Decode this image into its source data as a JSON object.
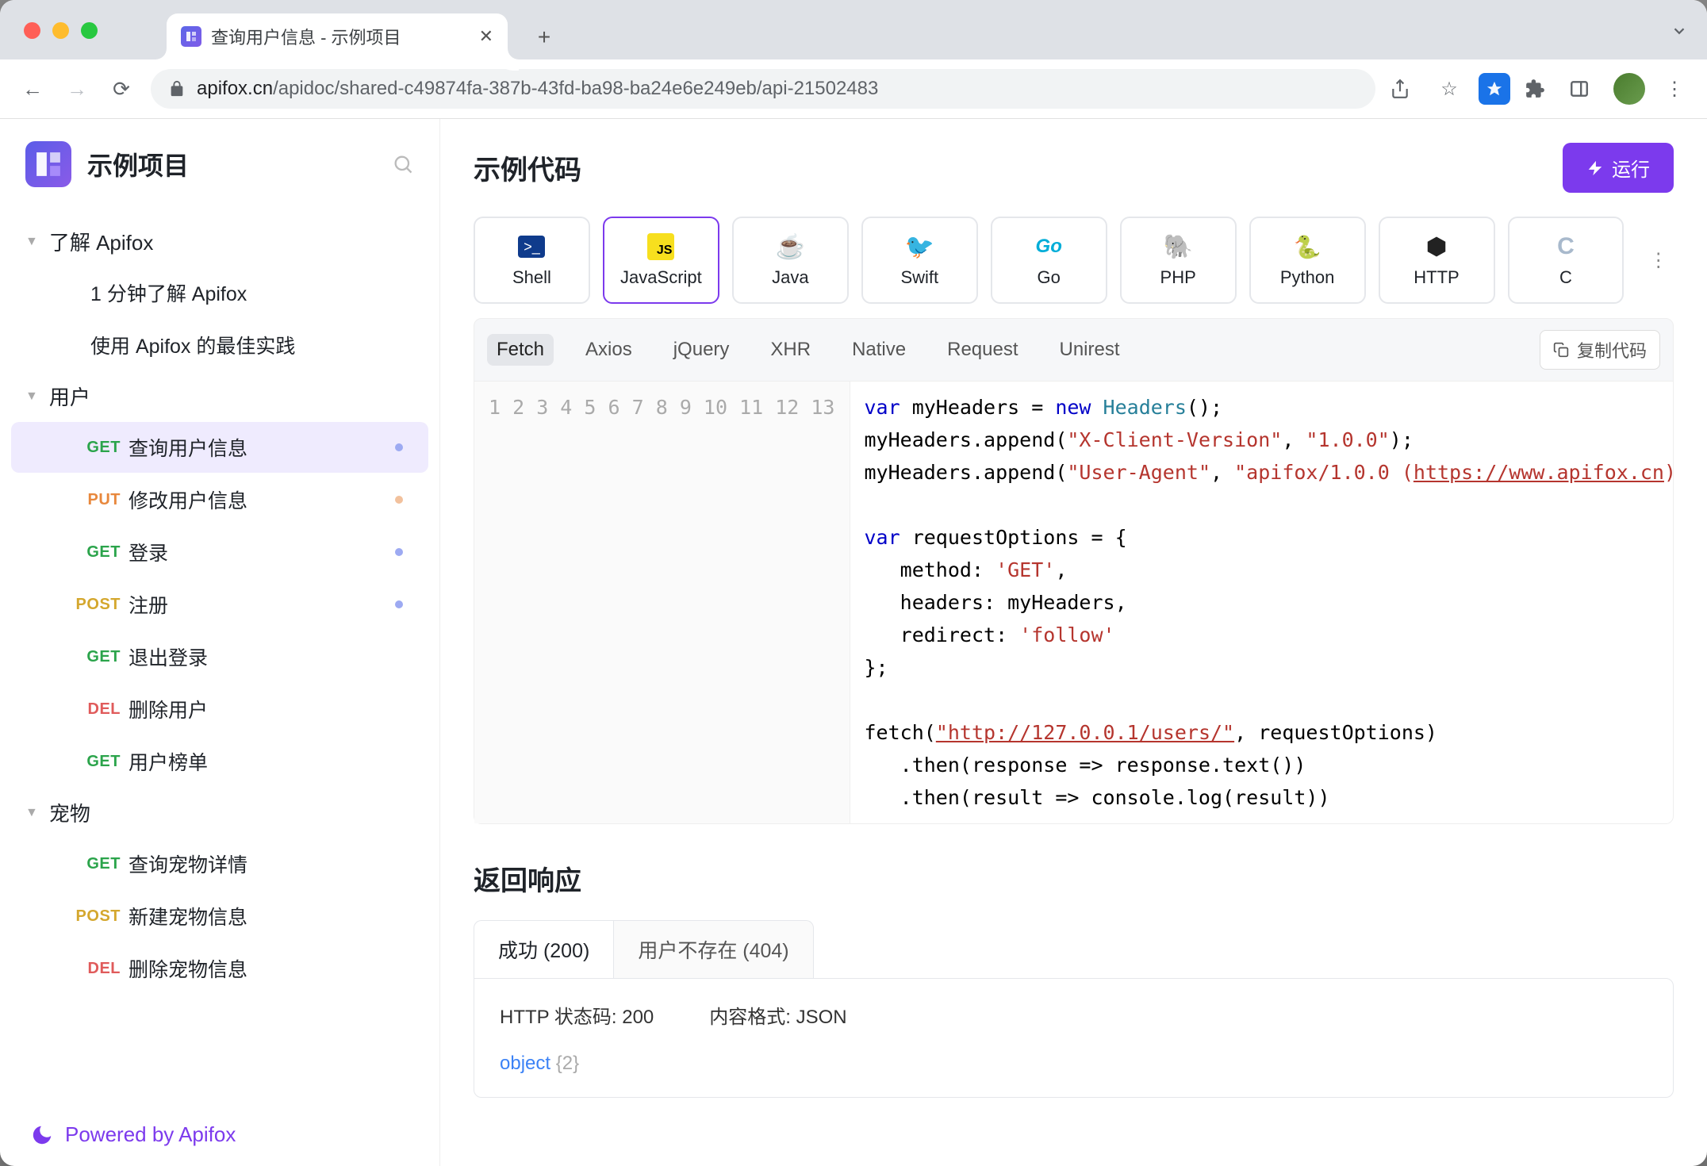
{
  "browser": {
    "tab_title": "查询用户信息 - 示例项目",
    "url_domain": "apifox.cn",
    "url_path": "/apidoc/shared-c49874fa-387b-43fd-ba98-ba24e6e249eb/api-21502483"
  },
  "sidebar": {
    "project": "示例项目",
    "groups": [
      {
        "label": "了解 Apifox",
        "expanded": true,
        "items": [
          {
            "type": "doc",
            "label": "1 分钟了解 Apifox"
          },
          {
            "type": "doc",
            "label": "使用 Apifox 的最佳实践"
          }
        ]
      },
      {
        "label": "用户",
        "expanded": true,
        "items": [
          {
            "type": "api",
            "method": "GET",
            "label": "查询用户信息",
            "active": true,
            "dot": "blue"
          },
          {
            "type": "api",
            "method": "PUT",
            "label": "修改用户信息",
            "dot": "orange"
          },
          {
            "type": "api",
            "method": "GET",
            "label": "登录",
            "dot": "blue"
          },
          {
            "type": "api",
            "method": "POST",
            "label": "注册",
            "dot": "blue"
          },
          {
            "type": "api",
            "method": "GET",
            "label": "退出登录"
          },
          {
            "type": "api",
            "method": "DEL",
            "label": "删除用户"
          },
          {
            "type": "api",
            "method": "GET",
            "label": "用户榜单"
          }
        ]
      },
      {
        "label": "宠物",
        "expanded": true,
        "items": [
          {
            "type": "api",
            "method": "GET",
            "label": "查询宠物详情"
          },
          {
            "type": "api",
            "method": "POST",
            "label": "新建宠物信息"
          },
          {
            "type": "api",
            "method": "DEL",
            "label": "删除宠物信息"
          }
        ]
      }
    ],
    "footer": "Powered by Apifox"
  },
  "main": {
    "section_title": "示例代码",
    "run_button": "运行",
    "languages": [
      "Shell",
      "JavaScript",
      "Java",
      "Swift",
      "Go",
      "PHP",
      "Python",
      "HTTP",
      "C"
    ],
    "active_lang": "JavaScript",
    "libs": [
      "Fetch",
      "Axios",
      "jQuery",
      "XHR",
      "Native",
      "Request",
      "Unirest"
    ],
    "active_lib": "Fetch",
    "copy_label": "复制代码",
    "code_lines": 13,
    "code_tokens": {
      "l1": {
        "var": "var",
        "name": " myHeaders = ",
        "new": "new",
        "cls": " Headers",
        "tail": "();"
      },
      "l2": {
        "pre": "myHeaders.append(",
        "k": "\"X-Client-Version\"",
        "sep": ", ",
        "v": "\"1.0.0\"",
        "post": ");"
      },
      "l3": {
        "pre": "myHeaders.append(",
        "k": "\"User-Agent\"",
        "sep": ", ",
        "v1": "\"apifox/1.0.0 (",
        "link": "https://www.apifox.cn",
        "v2": ")\"",
        "post": ");"
      },
      "l5": {
        "var": "var",
        "rest": " requestOptions = {"
      },
      "l6": {
        "key": "   method: ",
        "val": "'GET'",
        "c": ","
      },
      "l7": "   headers: myHeaders,",
      "l8": {
        "key": "   redirect: ",
        "val": "'follow'"
      },
      "l9": "};",
      "l11": {
        "pre": "fetch(",
        "url": "\"http://127.0.0.1/users/\"",
        "post": ", requestOptions)"
      },
      "l12": "   .then(response => response.text())",
      "l13": "   .then(result => console.log(result))"
    },
    "response": {
      "title": "返回响应",
      "tabs": [
        "成功 (200)",
        "用户不存在 (404)"
      ],
      "active_tab": "成功 (200)",
      "status_label": "HTTP 状态码: ",
      "status_value": "200",
      "content_label": "内容格式: ",
      "content_value": "JSON",
      "schema_type": "object",
      "schema_count": "{2}"
    }
  }
}
